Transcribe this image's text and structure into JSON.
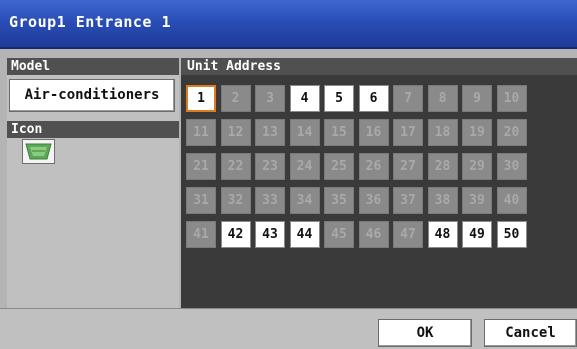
{
  "window": {
    "title": "Group1 Entrance 1"
  },
  "model": {
    "header": "Model",
    "button_label": "Air-conditioners"
  },
  "icon_section": {
    "header": "Icon",
    "icon": "air-conditioner-icon"
  },
  "unit_address": {
    "header": "Unit Address",
    "selected": "1",
    "rows": [
      [
        {
          "n": "1",
          "on": true
        },
        {
          "n": "2",
          "on": false
        },
        {
          "n": "3",
          "on": false
        },
        {
          "n": "4",
          "on": true
        },
        {
          "n": "5",
          "on": true
        },
        {
          "n": "6",
          "on": true
        },
        {
          "n": "7",
          "on": false
        },
        {
          "n": "8",
          "on": false
        },
        {
          "n": "9",
          "on": false
        },
        {
          "n": "10",
          "on": false
        }
      ],
      [
        {
          "n": "11",
          "on": false
        },
        {
          "n": "12",
          "on": false
        },
        {
          "n": "13",
          "on": false
        },
        {
          "n": "14",
          "on": false
        },
        {
          "n": "15",
          "on": false
        },
        {
          "n": "16",
          "on": false
        },
        {
          "n": "17",
          "on": false
        },
        {
          "n": "18",
          "on": false
        },
        {
          "n": "19",
          "on": false
        },
        {
          "n": "20",
          "on": false
        }
      ],
      [
        {
          "n": "21",
          "on": false
        },
        {
          "n": "22",
          "on": false
        },
        {
          "n": "23",
          "on": false
        },
        {
          "n": "24",
          "on": false
        },
        {
          "n": "25",
          "on": false
        },
        {
          "n": "26",
          "on": false
        },
        {
          "n": "27",
          "on": false
        },
        {
          "n": "28",
          "on": false
        },
        {
          "n": "29",
          "on": false
        },
        {
          "n": "30",
          "on": false
        }
      ],
      [
        {
          "n": "31",
          "on": false
        },
        {
          "n": "32",
          "on": false
        },
        {
          "n": "33",
          "on": false
        },
        {
          "n": "34",
          "on": false
        },
        {
          "n": "35",
          "on": false
        },
        {
          "n": "36",
          "on": false
        },
        {
          "n": "37",
          "on": false
        },
        {
          "n": "38",
          "on": false
        },
        {
          "n": "39",
          "on": false
        },
        {
          "n": "40",
          "on": false
        }
      ],
      [
        {
          "n": "41",
          "on": false
        },
        {
          "n": "42",
          "on": true
        },
        {
          "n": "43",
          "on": true
        },
        {
          "n": "44",
          "on": true
        },
        {
          "n": "45",
          "on": false
        },
        {
          "n": "46",
          "on": false
        },
        {
          "n": "47",
          "on": false
        },
        {
          "n": "48",
          "on": true
        },
        {
          "n": "49",
          "on": true
        },
        {
          "n": "50",
          "on": true
        }
      ]
    ]
  },
  "actions": {
    "ok_label": "OK",
    "cancel_label": "Cancel"
  },
  "colors": {
    "title_bar": "#2a4eb6",
    "selection": "#e07a1e",
    "active_cell": "#ffffff",
    "inactive_cell": "#8a8a8a"
  }
}
